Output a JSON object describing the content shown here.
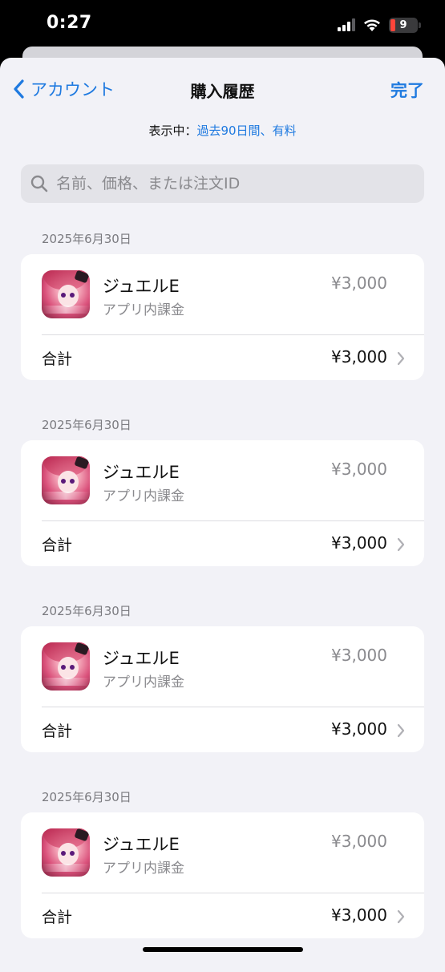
{
  "status": {
    "time": "0:27",
    "battery": "9"
  },
  "nav": {
    "back_label": "アカウント",
    "title": "購入履歴",
    "done_label": "完了"
  },
  "filter": {
    "prefix": "表示中：",
    "value": "過去90日間、有料"
  },
  "search": {
    "placeholder": "名前、価格、または注文ID"
  },
  "colors": {
    "accent": "#1f7ae0",
    "background": "#f2f2f7",
    "battery_low": "#ff453a"
  },
  "purchases": [
    {
      "date": "2025年6月30日",
      "name": "ジュエルE",
      "type": "アプリ内課金",
      "price": "¥3,000",
      "total_label": "合計",
      "total": "¥3,000",
      "icon": "app-icon"
    },
    {
      "date": "2025年6月30日",
      "name": "ジュエルE",
      "type": "アプリ内課金",
      "price": "¥3,000",
      "total_label": "合計",
      "total": "¥3,000",
      "icon": "app-icon"
    },
    {
      "date": "2025年6月30日",
      "name": "ジュエルE",
      "type": "アプリ内課金",
      "price": "¥3,000",
      "total_label": "合計",
      "total": "¥3,000",
      "icon": "app-icon"
    },
    {
      "date": "2025年6月30日",
      "name": "ジュエルE",
      "type": "アプリ内課金",
      "price": "¥3,000",
      "total_label": "合計",
      "total": "¥3,000",
      "icon": "app-icon"
    }
  ]
}
